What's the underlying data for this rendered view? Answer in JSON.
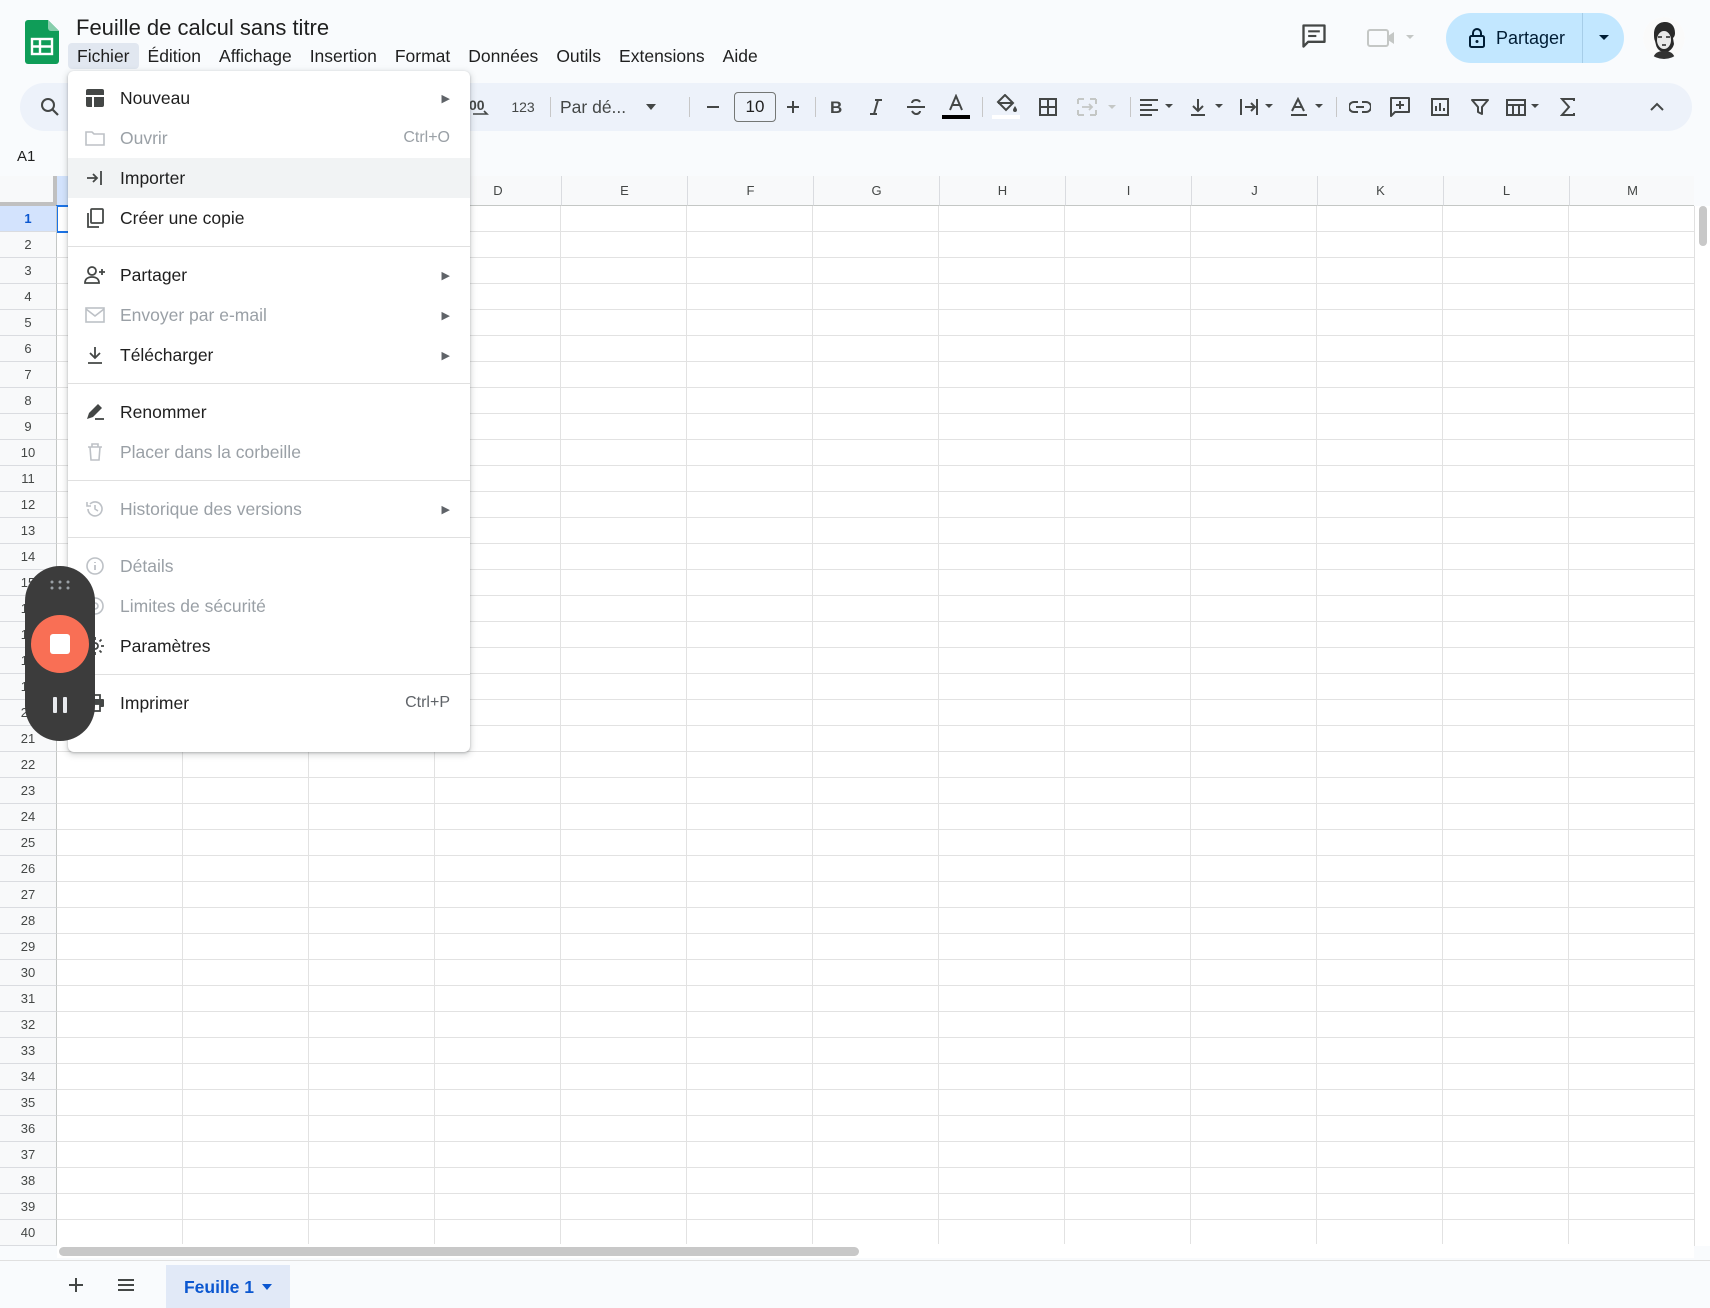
{
  "title": "Feuille de calcul sans titre",
  "menu": [
    "Fichier",
    "Édition",
    "Affichage",
    "Insertion",
    "Format",
    "Données",
    "Outils",
    "Extensions",
    "Aide"
  ],
  "share": {
    "label": "Partager"
  },
  "toolbar": {
    "zoom_fmt": "123",
    "font": "Par dé...",
    "font_size": "10"
  },
  "namebox": "A1",
  "columns": [
    "D",
    "E",
    "F",
    "G",
    "H",
    "I",
    "J",
    "K",
    "L",
    "M"
  ],
  "rows": [
    "1",
    "2",
    "3",
    "4",
    "5",
    "6",
    "7",
    "8",
    "9",
    "10",
    "11",
    "12",
    "13",
    "14",
    "15",
    "16",
    "17",
    "18",
    "19",
    "20",
    "21",
    "22",
    "23",
    "24",
    "25",
    "26",
    "27",
    "28",
    "29",
    "30",
    "31",
    "32",
    "33",
    "34",
    "35",
    "36",
    "37",
    "38",
    "39",
    "40"
  ],
  "file_menu": {
    "new": "Nouveau",
    "open": "Ouvrir",
    "open_sc": "Ctrl+O",
    "import": "Importer",
    "copy": "Créer une copie",
    "share": "Partager",
    "email": "Envoyer par e-mail",
    "download": "Télécharger",
    "rename": "Renommer",
    "trash": "Placer dans la corbeille",
    "history": "Historique des versions",
    "details": "Détails",
    "security": "Limites de sécurité",
    "settings": "Paramètres",
    "print": "Imprimer",
    "print_sc": "Ctrl+P"
  },
  "sheet_tab": "Feuille 1",
  "colors": {
    "accent": "#0b57d0",
    "share_bg": "#c2e7ff",
    "record": "#f96f55",
    "logo": "#0f9d58"
  }
}
